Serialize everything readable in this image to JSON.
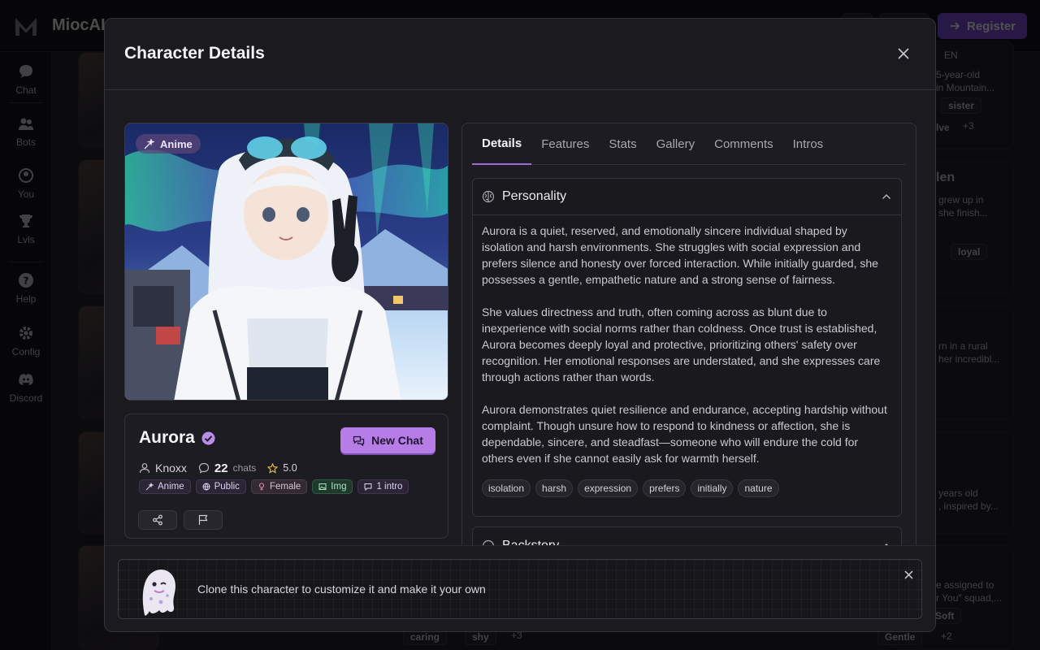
{
  "app": {
    "brand": "MiocAI",
    "register_label": "Register",
    "sidebar": [
      {
        "label": "Chat",
        "icon": "chat-bubble-icon"
      },
      {
        "label": "Bots",
        "icon": "people-icon"
      },
      {
        "label": "You",
        "icon": "user-icon"
      },
      {
        "label": "Lvls",
        "icon": "trophy-icon"
      },
      {
        "label": "Help",
        "icon": "help-icon"
      },
      {
        "label": "Config",
        "icon": "gear-icon"
      },
      {
        "label": "Discord",
        "icon": "discord-icon"
      }
    ],
    "background_cards": {
      "lang": "EN",
      "snippets": [
        "5-year-old",
        "in Mountain...",
        "grew up in",
        "she finish...",
        "rn in a rural",
        "her incredibl...",
        "years old",
        ", inspired by...",
        "e assigned to",
        "r You\" squad,...",
        "len"
      ],
      "tags": [
        "sister",
        "lve",
        "+3",
        "l",
        "loyal",
        "caring",
        "shy",
        "+3",
        "Soft",
        "Gentle",
        "+2"
      ]
    }
  },
  "modal": {
    "title": "Character Details",
    "portrait_badge": "Anime",
    "character": {
      "name": "Aurora",
      "creator": "Knoxx",
      "chats": "22",
      "chats_label": "chats",
      "rating": "5.0",
      "new_chat_label": "New Chat",
      "chips": [
        "Anime",
        "Public",
        "Female",
        "Img",
        "1 intro"
      ]
    },
    "tabs": [
      "Details",
      "Features",
      "Stats",
      "Gallery",
      "Comments",
      "Intros"
    ],
    "active_tab": "Details",
    "personality": {
      "title": "Personality",
      "paragraphs": [
        "Aurora is a quiet, reserved, and emotionally sincere individual shaped by isolation and harsh environments. She struggles with social expression and prefers silence and honesty over forced interaction. While initially guarded, she possesses a gentle, empathetic nature and a strong sense of fairness.",
        "She values directness and truth, often coming across as blunt due to inexperience with social norms rather than coldness. Once trust is established, Aurora becomes deeply loyal and protective, prioritizing others' safety over recognition. Her emotional responses are understated, and she expresses care through actions rather than words.",
        "Aurora demonstrates quiet resilience and endurance, accepting hardship without complaint. Though unsure how to respond to kindness or affection, she is dependable, sincere, and steadfast—someone who will endure the cold for others even if she cannot easily ask for warmth herself."
      ],
      "keywords": [
        "isolation",
        "harsh",
        "expression",
        "prefers",
        "initially",
        "nature"
      ]
    },
    "backstory": {
      "title": "Backstory"
    },
    "clone_banner": {
      "text": "Clone this character to customize it and make it your own"
    }
  }
}
